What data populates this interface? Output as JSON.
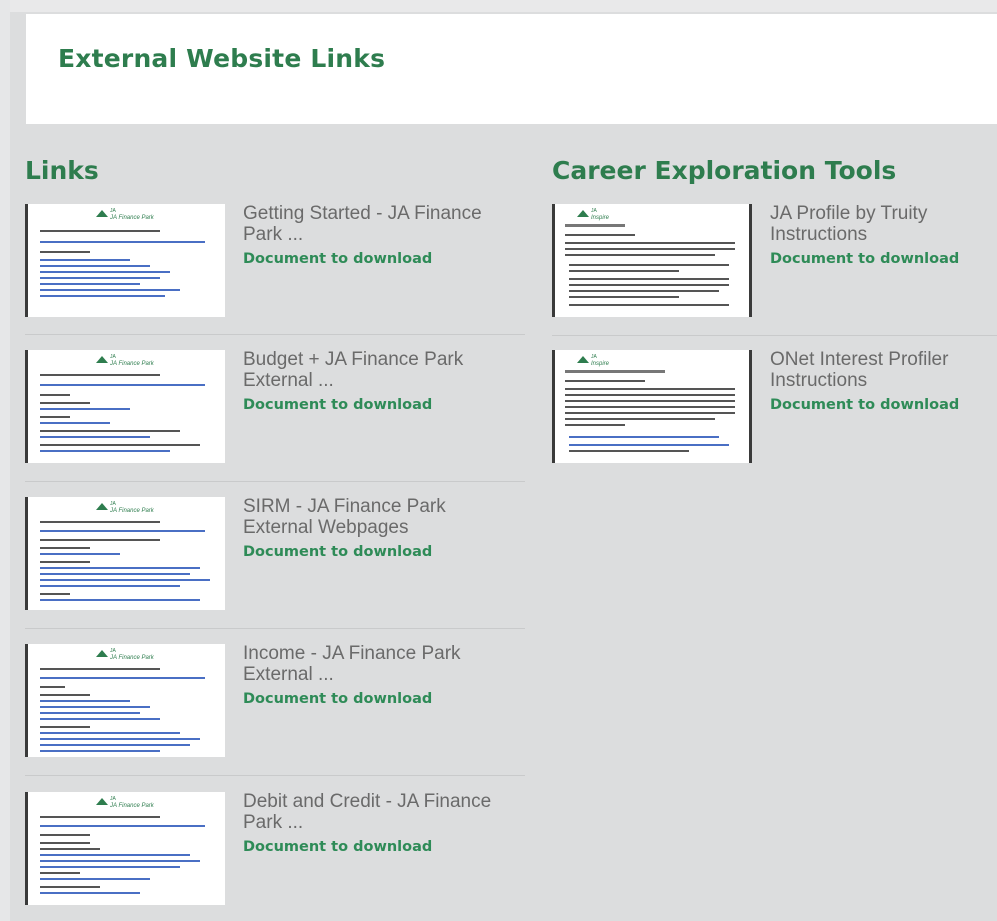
{
  "header": {
    "title": "External Website Links"
  },
  "links": {
    "title": "Links",
    "items": [
      {
        "name": "Getting Started - JA Finance Park ...",
        "download": "Document to download"
      },
      {
        "name": "Budget + JA Finance Park External ...",
        "download": "Document to download"
      },
      {
        "name": "SIRM - JA Finance Park External Webpages",
        "download": "Document to download"
      },
      {
        "name": "Income - JA Finance Park External ...",
        "download": "Document to download"
      },
      {
        "name": "Debit and Credit - JA Finance Park ...",
        "download": "Document to download"
      }
    ]
  },
  "career": {
    "title": "Career Exploration Tools",
    "items": [
      {
        "name": "JA Profile by Truity Instructions",
        "download": "Document to download"
      },
      {
        "name": "ONet Interest Profiler Instructions",
        "download": "Document to download"
      }
    ]
  },
  "colors": {
    "accent": "#2e7d4e",
    "link_green": "#2e8b57",
    "page_bg": "#dcddde"
  }
}
